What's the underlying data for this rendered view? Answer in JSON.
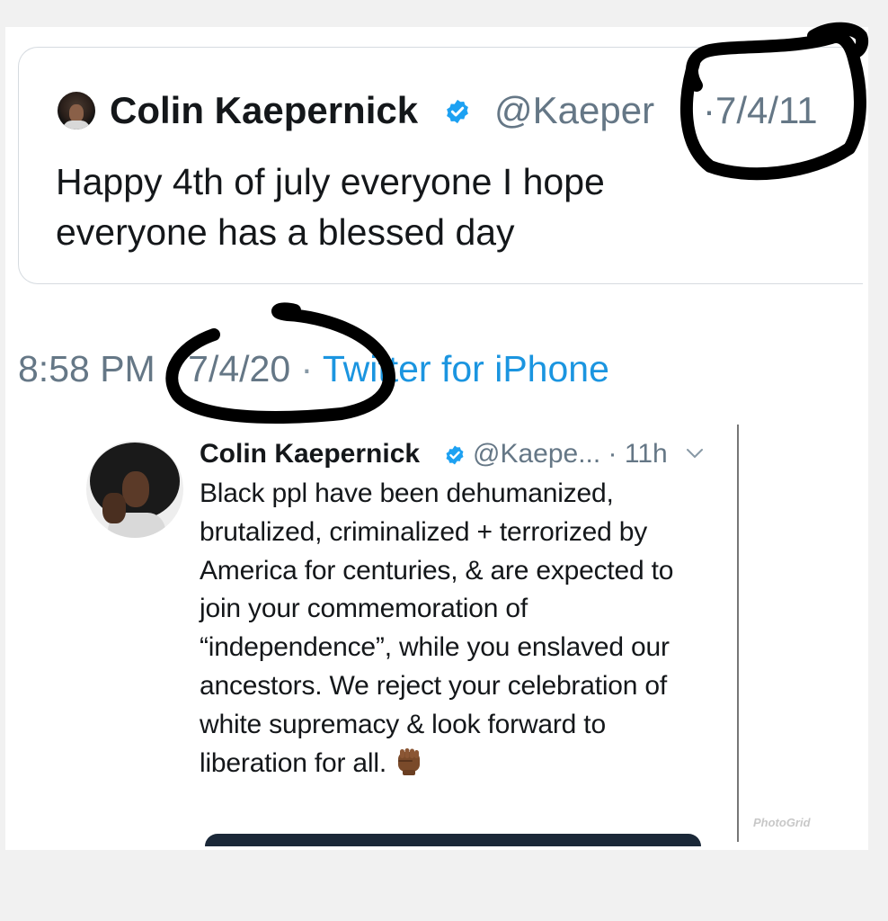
{
  "quoted_tweet": {
    "name": "Colin Kaepernick",
    "handle": "@Kaeper",
    "date": "·7/4/11",
    "text": "Happy 4th of july everyone I hope everyone has a blessed day"
  },
  "tweet_meta": {
    "time": "8:58 PM",
    "separator1": " · ",
    "date": "7/4/20",
    "separator2": " · ",
    "app": "Twitter for iPhone"
  },
  "embedded_tweet": {
    "name": "Colin Kaepernick",
    "handle_time": "@Kaepe... · 11h",
    "text": "Black ppl have been dehumanized, brutalized, criminalized + terrorized by America for centuries, & are expected to join your commemoration of “independence”, while you enslaved our ancestors. We reject your celebration of white supremacy & look forward to liberation for all."
  },
  "watermark": "PhotoGrid",
  "colors": {
    "text_primary": "#14171a",
    "text_secondary": "#657786",
    "link_blue": "#1b95e0",
    "verified_blue": "#1da1f2",
    "marker": "#000000"
  },
  "icons": [
    "verified-badge-icon",
    "chevron-down-icon",
    "raised-fist-emoji-icon"
  ]
}
